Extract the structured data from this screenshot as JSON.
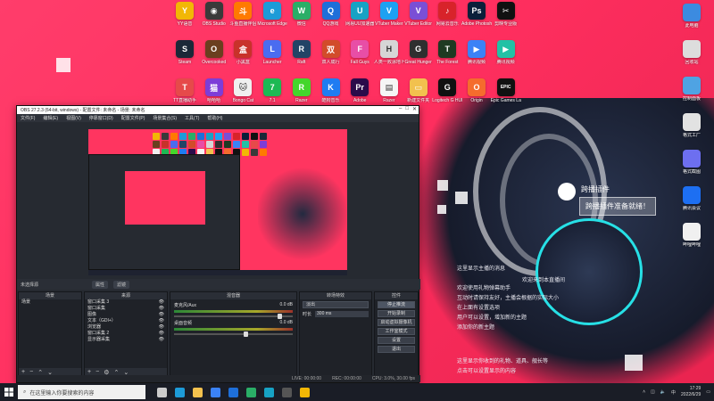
{
  "desktop": {
    "icons": [
      {
        "label": "YY语音",
        "color": "#f2b705",
        "glyph": "Y"
      },
      {
        "label": "OBS Studio",
        "color": "#3a3a3a",
        "glyph": "◉"
      },
      {
        "label": "斗鱼直播伴侣",
        "color": "#ff7a00",
        "glyph": "斗"
      },
      {
        "label": "Microsoft Edge",
        "color": "#1d9bd8",
        "glyph": "e"
      },
      {
        "label": "微信",
        "color": "#2aae67",
        "glyph": "W"
      },
      {
        "label": "QQ游戏",
        "color": "#1e6fd9",
        "glyph": "Q"
      },
      {
        "label": "网易UU加速器",
        "color": "#17a2c4",
        "glyph": "U"
      },
      {
        "label": "VTuber Maker",
        "color": "#1da1f2",
        "glyph": "V"
      },
      {
        "label": "VTuber Editor",
        "color": "#7a4fd6",
        "glyph": "V"
      },
      {
        "label": "网易云音乐",
        "color": "#d8232a",
        "glyph": "♪"
      },
      {
        "label": "Adobe Photosh...",
        "color": "#0b1f3a",
        "glyph": "Ps"
      },
      {
        "label": "剪映专业版",
        "color": "#111111",
        "glyph": "✂"
      },
      {
        "label": "Steam",
        "color": "#1b2838",
        "glyph": "S"
      },
      {
        "label": "Overcooked",
        "color": "#6b3f1f",
        "glyph": "O"
      },
      {
        "label": "小黑盒",
        "color": "#c8322a",
        "glyph": "盒"
      },
      {
        "label": "Launcher",
        "color": "#4a6cf0",
        "glyph": "L"
      },
      {
        "label": "Raft",
        "color": "#224466",
        "glyph": "R"
      },
      {
        "label": "双人成行",
        "color": "#d24c2a",
        "glyph": "双"
      },
      {
        "label": "Fall Guys",
        "color": "#e84ea6",
        "glyph": "F"
      },
      {
        "label": "人类一败涂地 Human Fa...",
        "color": "#d6d6d6",
        "glyph": "H"
      },
      {
        "label": "Great Hunger",
        "color": "#2f2f2f",
        "glyph": "G"
      },
      {
        "label": "The Forest",
        "color": "#1e3a22",
        "glyph": "T"
      },
      {
        "label": "腾讯视频",
        "color": "#3b82f6",
        "glyph": "▶"
      },
      {
        "label": "腾讯视频",
        "color": "#22c1a5",
        "glyph": "▶"
      },
      {
        "label": "TT直播助手",
        "color": "#e64a4a",
        "glyph": "T"
      },
      {
        "label": "哈哈哈",
        "color": "#7d3dd8",
        "glyph": "猫"
      },
      {
        "label": "Bongo Cat",
        "color": "#f0f0f0",
        "glyph": "🐱"
      },
      {
        "label": "7.1",
        "color": "#1db954",
        "glyph": "7"
      },
      {
        "label": "Razer",
        "color": "#44d62c",
        "glyph": "R"
      },
      {
        "label": "酷狗音乐",
        "color": "#1f7cf2",
        "glyph": "K"
      },
      {
        "label": "Adobe",
        "color": "#2b0b4a",
        "glyph": "Pr"
      },
      {
        "label": "Razer",
        "color": "#f5f5f5",
        "glyph": "▤"
      },
      {
        "label": "新建文件夹",
        "color": "#f2c14e",
        "glyph": "▭"
      },
      {
        "label": "Logitech G HUB",
        "color": "#111111",
        "glyph": "G"
      },
      {
        "label": "Origin",
        "color": "#f56c2d",
        "glyph": "O"
      },
      {
        "label": "Epic Games Launcher",
        "color": "#111111",
        "glyph": "EPIC"
      }
    ],
    "right_icons": [
      {
        "label": "此电脑",
        "color": "#3c8be0"
      },
      {
        "label": "回收站",
        "color": "#dddddd"
      },
      {
        "label": "控制面板",
        "color": "#4fa3e3"
      },
      {
        "label": "格式工厂",
        "color": "#e2e2e2"
      },
      {
        "label": "格式截图",
        "color": "#6d6ff0"
      },
      {
        "label": "腾讯会议",
        "color": "#1d6ff2"
      },
      {
        "label": "哔哩哔哩",
        "color": "#f0f0f0"
      }
    ],
    "plugin_notice": {
      "title": "跨播插件",
      "message": "跨播插件准备就绪！"
    },
    "wallpaper_lines": [
      "这里显示主播的消息",
      "欢迎来到本直播间",
      "欢迎使用礼物弹幕助手",
      "互动时请保持友好，主播会根据的实际大小",
      "在上面有设置选项",
      "用户可以设置，增加新的主题",
      "添加你的新主题",
      "这里显示你收到的礼物、道具、舰长等",
      "点击可以设置显示的内容"
    ]
  },
  "obs": {
    "title": "OBS 27.2.3 (64-bit, windows) - 配置文件: 未命名 - 场景: 未命名",
    "menu": [
      "文件(F)",
      "编辑(E)",
      "视图(V)",
      "停靠窗口(D)",
      "配置文件(P)",
      "场景集合(S)",
      "工具(T)",
      "帮助(H)"
    ],
    "toolbar_label": "未选择源",
    "toolbar_buttons": [
      "属性",
      "滤镜"
    ],
    "scenes": {
      "title": "场景",
      "items": [
        "场景"
      ]
    },
    "sources": {
      "title": "来源",
      "items": [
        "窗口采集 3",
        "窗口采集",
        "图像",
        "文本（GDI+）",
        "浏览器",
        "窗口采集 2",
        "显示器采集"
      ]
    },
    "mixer": {
      "title": "混音器",
      "channels": [
        {
          "name": "麦克风/Aux",
          "value": "0.0 dB",
          "level": 0.92
        },
        {
          "name": "桌面音频",
          "value": "0.0 dB",
          "level": 0.62
        }
      ]
    },
    "transitions": {
      "title": "转场特效",
      "mode": "淡出",
      "duration_label": "时长",
      "duration": "300 ms"
    },
    "controls": {
      "title": "控件",
      "buttons": [
        "停止推流",
        "开始录制",
        "启动虚拟摄像机",
        "工作室模式",
        "设置",
        "退出"
      ]
    },
    "status": [
      "LIVE: 00:00:00",
      "REC: 00:00:00",
      "CPU: 3.0%, 30.00 fps"
    ]
  },
  "taskbar": {
    "search_placeholder": "在这里输入你要搜索的内容",
    "apps": [
      {
        "name": "task-view",
        "color": "#cccccc"
      },
      {
        "name": "edge",
        "color": "#1d9bd8"
      },
      {
        "name": "file-explorer",
        "color": "#f2c14e"
      },
      {
        "name": "store",
        "color": "#3b82f6"
      },
      {
        "name": "mail",
        "color": "#1e6fd9"
      },
      {
        "name": "wechat",
        "color": "#2aae67"
      },
      {
        "name": "netease",
        "color": "#17a2c4"
      },
      {
        "name": "obs",
        "color": "#555555"
      },
      {
        "name": "app",
        "color": "#f2b705"
      }
    ],
    "tray_text": "中",
    "time": "17:29",
    "date": "2022/6/29"
  }
}
